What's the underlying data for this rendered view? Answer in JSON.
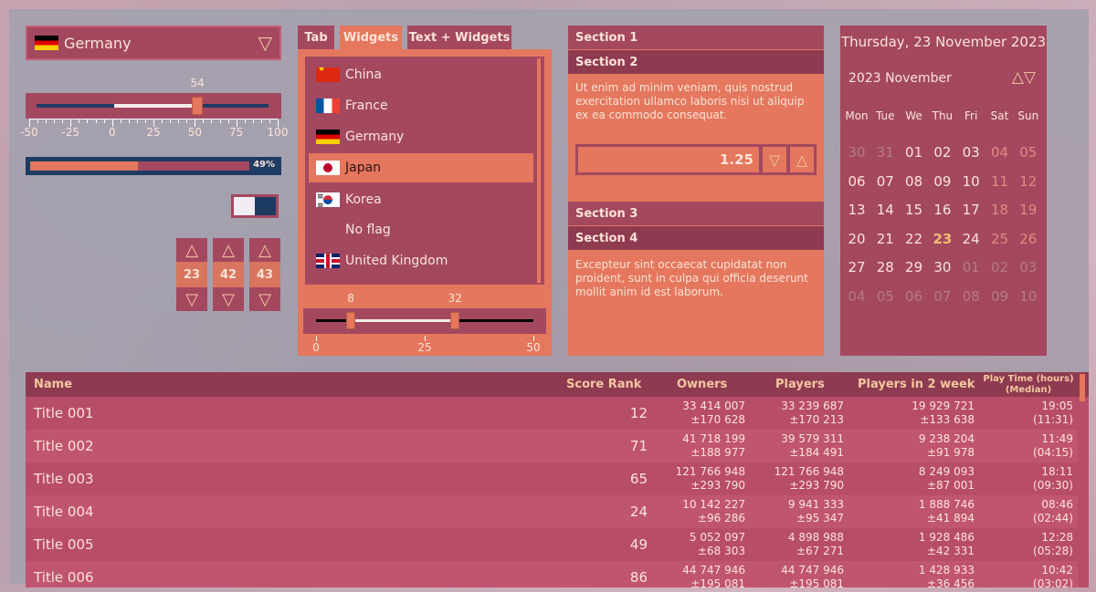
{
  "combo": {
    "selected": "Germany",
    "arrow": "▽"
  },
  "slider1": {
    "value": "54",
    "min": -50,
    "max": 100,
    "current": 54,
    "ticks": [
      "-50",
      "-25",
      "0",
      "25",
      "50",
      "75",
      "100"
    ]
  },
  "progress": {
    "value": 49,
    "label": "49%"
  },
  "toggle": {
    "on": false
  },
  "steppers": [
    {
      "up": "△",
      "value": "23",
      "down": "▽"
    },
    {
      "up": "△",
      "value": "42",
      "down": "▽"
    },
    {
      "up": "△",
      "value": "43",
      "down": "▽"
    }
  ],
  "tabs": [
    "Tab",
    "Widgets",
    "Text + Widgets"
  ],
  "countries": [
    {
      "name": "China",
      "flag": "cn"
    },
    {
      "name": "France",
      "flag": "fr"
    },
    {
      "name": "Germany",
      "flag": "de"
    },
    {
      "name": "Japan",
      "flag": "jp",
      "selected": true
    },
    {
      "name": "Korea",
      "flag": "kr"
    },
    {
      "name": "No flag",
      "flag": "none"
    },
    {
      "name": "United Kingdom",
      "flag": "uk"
    }
  ],
  "range_slider": {
    "low": "8",
    "high": "32",
    "low_value": 8,
    "high_value": 32,
    "min": 0,
    "max": 50,
    "ticks": [
      "0",
      "25",
      "50"
    ]
  },
  "accordion": {
    "section1": "Section 1",
    "section2": "Section 2",
    "section2_text": "Ut enim ad minim veniam, quis nostrud exercitation ullamco laboris nisi ut aliquip ex ea commodo consequat.",
    "spin_value": "1.25",
    "spin_down": "▽",
    "spin_up": "△",
    "section3": "Section 3",
    "section4": "Section 4",
    "section4_text": "Excepteur sint occaecat cupidatat non proident, sunt in culpa qui officia deserunt mollit anim id est laborum."
  },
  "calendar": {
    "title": "Thursday, 23 November 2023",
    "month": "2023 November",
    "nav": "△▽",
    "weekdays": [
      "Mon",
      "Tue",
      "We",
      "Thu",
      "Fri",
      "Sat",
      "Sun"
    ],
    "weeks": [
      [
        "30",
        "31",
        "01",
        "02",
        "03",
        "04",
        "05"
      ],
      [
        "06",
        "07",
        "08",
        "09",
        "10",
        "11",
        "12"
      ],
      [
        "13",
        "14",
        "15",
        "16",
        "17",
        "18",
        "19"
      ],
      [
        "20",
        "21",
        "22",
        "23",
        "24",
        "25",
        "26"
      ],
      [
        "27",
        "28",
        "29",
        "30",
        "01",
        "02",
        "03"
      ],
      [
        "04",
        "05",
        "06",
        "07",
        "08",
        "09",
        "10"
      ]
    ],
    "today": "23"
  },
  "table": {
    "headers": {
      "name": "Name",
      "score": "Score Rank",
      "owners": "Owners",
      "players": "Players",
      "players2w": "Players in 2 week",
      "playtime_1": "Play Time (hours)",
      "playtime_2": "(Median)"
    },
    "rows": [
      {
        "name": "Title 001",
        "score": "12",
        "owners": "33 414 007",
        "owners_pm": "±170 628",
        "players": "33 239 687",
        "players_pm": "±170 213",
        "p2w": "19 929 721",
        "p2w_pm": "±133 638",
        "time": "19:05",
        "median": "(11:31)"
      },
      {
        "name": "Title 002",
        "score": "71",
        "owners": "41 718 199",
        "owners_pm": "±188 977",
        "players": "39 579 311",
        "players_pm": "±184 491",
        "p2w": "9 238 204",
        "p2w_pm": "±91 978",
        "time": "11:49",
        "median": "(04:15)"
      },
      {
        "name": "Title 003",
        "score": "65",
        "owners": "121 766 948",
        "owners_pm": "±293 790",
        "players": "121 766 948",
        "players_pm": "±293 790",
        "p2w": "8 249 093",
        "p2w_pm": "±87 001",
        "time": "18:11",
        "median": "(09:30)"
      },
      {
        "name": "Title 004",
        "score": "24",
        "owners": "10 142 227",
        "owners_pm": "±96 286",
        "players": "9 941 333",
        "players_pm": "±95 347",
        "p2w": "1 888 746",
        "p2w_pm": "±41 894",
        "time": "08:46",
        "median": "(02:44)"
      },
      {
        "name": "Title 005",
        "score": "49",
        "owners": "5 052 097",
        "owners_pm": "±68 303",
        "players": "4 898 988",
        "players_pm": "±67 271",
        "p2w": "1 928 486",
        "p2w_pm": "±42 331",
        "time": "12:28",
        "median": "(05:28)"
      },
      {
        "name": "Title 006",
        "score": "86",
        "owners": "44 747 946",
        "owners_pm": "±195 081",
        "players": "44 747 946",
        "players_pm": "±195 081",
        "p2w": "1 428 933",
        "p2w_pm": "±36 456",
        "time": "10:42",
        "median": "(03:02)"
      }
    ]
  }
}
